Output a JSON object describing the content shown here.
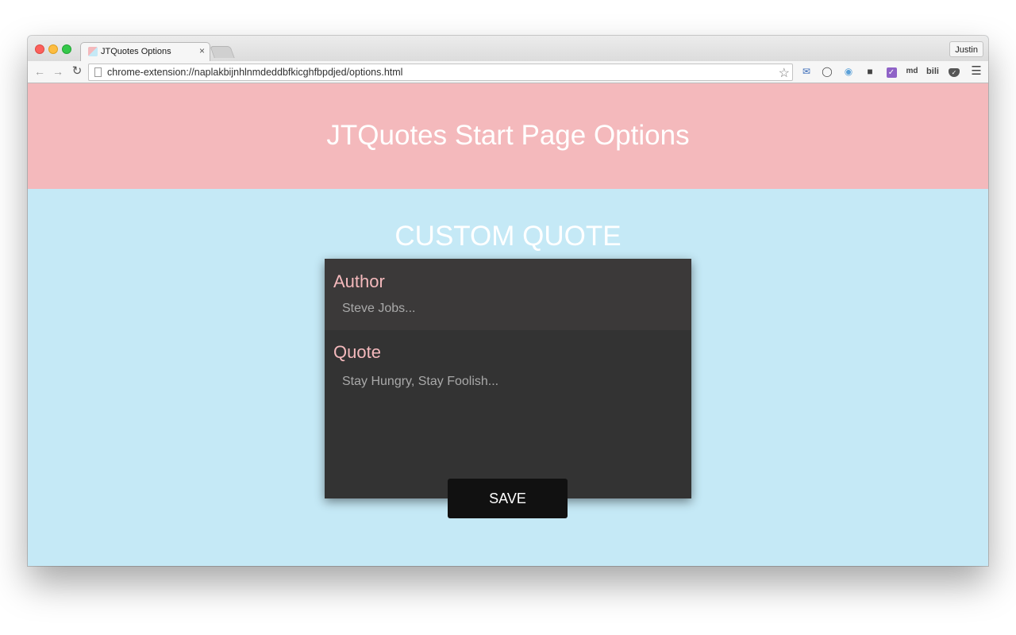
{
  "browser": {
    "tab_title": "JTQuotes Options",
    "tab_close": "×",
    "profile_name": "Justin",
    "url": "chrome-extension://naplakbijnhlnmdeddbfkicghfbpdjed/options.html",
    "extensions": [
      "mail-icon",
      "opera-icon",
      "camera-icon",
      "evernote-icon",
      "checklist-icon",
      "md",
      "bili",
      "pocket-icon",
      "menu-icon"
    ],
    "ext_md_label": "md",
    "ext_bili_label": "bili"
  },
  "page": {
    "header_title": "JTQuotes Start Page Options",
    "section_title": "CUSTOM QUOTE",
    "author": {
      "label": "Author",
      "placeholder": "Steve Jobs...",
      "value": ""
    },
    "quote": {
      "label": "Quote",
      "placeholder": "Stay Hungry, Stay Foolish...",
      "value": ""
    },
    "save_label": "SAVE"
  },
  "colors": {
    "header_bg": "#f4b9bc",
    "body_bg": "#c5e9f6",
    "card_bg": "#333333",
    "label_color": "#f4b9bc",
    "button_bg": "#111111"
  }
}
